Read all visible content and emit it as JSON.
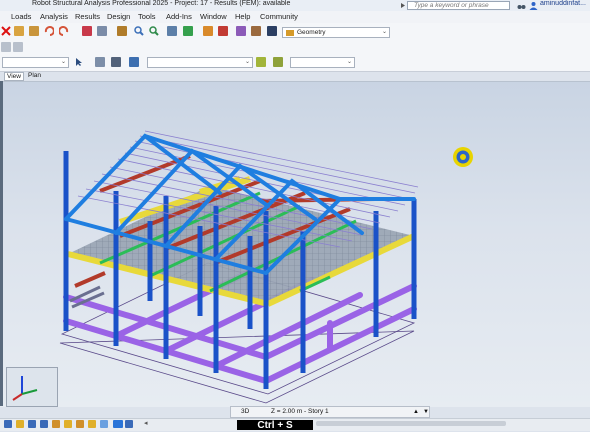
{
  "titlebar": {
    "title": "Robot Structural Analysis Professional 2025 - Project: 17 - Results (FEM): available",
    "search_placeholder": "Type a keyword or phrase",
    "user": "aminuddinfat..."
  },
  "menu": [
    "Loads",
    "Analysis",
    "Results",
    "Design",
    "Tools",
    "Add-Ins",
    "Window",
    "Help",
    "Community"
  ],
  "toolbar": {
    "layout_select": "Geometry"
  },
  "view_tabs": [
    "View",
    "Plan"
  ],
  "status": {
    "mode": "3D",
    "level": "Z = 2.00 m - Story 1"
  },
  "overlay_hint": "Ctrl + S",
  "colors": {
    "beam_blue": "#1f7ee0",
    "column_blue": "#1a52c8",
    "beam_yellow": "#e8d93a",
    "beam_red": "#b23a2a",
    "beam_green": "#2bbd57",
    "base_purple": "#9a63e6",
    "slab_grey": "#8a96a8",
    "cursor_ring": "#e8d400"
  }
}
